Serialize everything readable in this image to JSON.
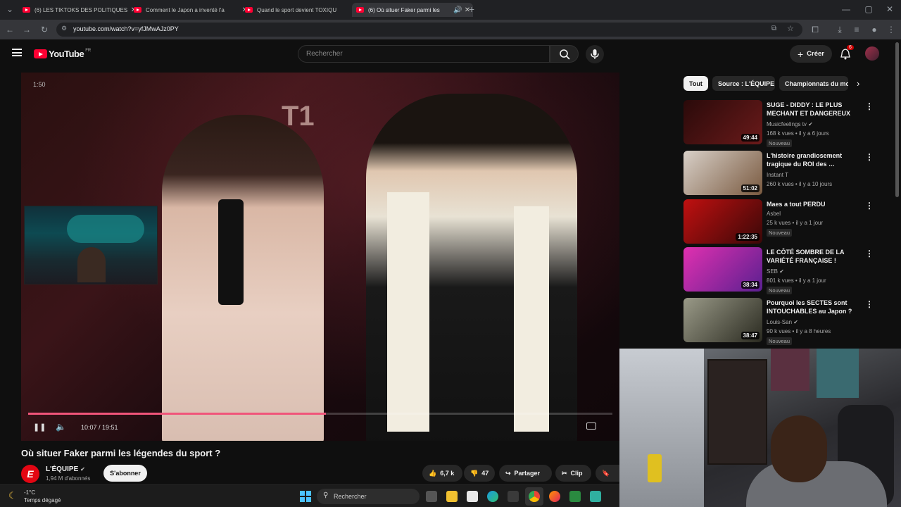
{
  "browser": {
    "tabs": [
      {
        "title": "(6) LES TIKTOKS DES POLITIQUES"
      },
      {
        "title": "Comment le Japon a inventé l'a"
      },
      {
        "title": "Quand le sport devient TOXIQU"
      },
      {
        "title": "(6) Où situer Faker parmi les"
      }
    ],
    "url": "youtube.com/watch?v=yfJMwAJz0PY"
  },
  "header": {
    "logo": "YouTube",
    "region": "FR",
    "search_placeholder": "Rechercher",
    "create_label": "Créer",
    "notif_count": "6"
  },
  "player": {
    "top_time": "1:50",
    "time": "10:07 / 19:51",
    "progress": 0.51
  },
  "video": {
    "title": "Où situer Faker parmi les légendes du sport ?",
    "channel": "L'ÉQUIPE",
    "subscribers": "1,94 M d'abonnés",
    "subscribe_label": "S'abonner",
    "likes": "6,7 k",
    "dislikes": "47",
    "share_label": "Partager",
    "clip_label": "Clip"
  },
  "chips": [
    "Tout",
    "Source : L'ÉQUIPE",
    "Championnats du mo"
  ],
  "recommendations": [
    {
      "title": "SUGE - DIDDY : LE PLUS MECHANT ET DANGEREUX DU…",
      "channel": "Musicfeelings tv",
      "meta": "168 k vues • il y a 6 jours",
      "badge": "Nouveau",
      "duration": "49:44",
      "thumb_color": "#5a1a1a"
    },
    {
      "title": "L'histoire grandiosement tragique du ROI des …",
      "channel": "Instant T",
      "meta": "260 k vues • il y a 10 jours",
      "badge": "",
      "duration": "51:02",
      "thumb_color": "#c8c0b8"
    },
    {
      "title": "Maes a tout PERDU",
      "channel": "Asbel",
      "meta": "25 k vues • il y a 1 jour",
      "badge": "Nouveau",
      "duration": "1:22:35",
      "thumb_color": "#8a1010"
    },
    {
      "title": "LE CÔTÉ SOMBRE DE LA VARIÉTÉ FRANÇAISE !",
      "channel": "SEB",
      "meta": "801 k vues • il y a 1 jour",
      "badge": "Nouveau",
      "duration": "38:34",
      "thumb_color": "#c0208a"
    },
    {
      "title": "Pourquoi les SECTES sont INTOUCHABLES au Japon ?",
      "channel": "Louis-San",
      "meta": "90 k vues • il y a 8 heures",
      "badge": "Nouveau",
      "duration": "38:47",
      "thumb_color": "#5a5a4a"
    }
  ],
  "taskbar": {
    "temperature": "-1°C",
    "weather": "Temps dégagé",
    "search_label": "Rechercher"
  }
}
